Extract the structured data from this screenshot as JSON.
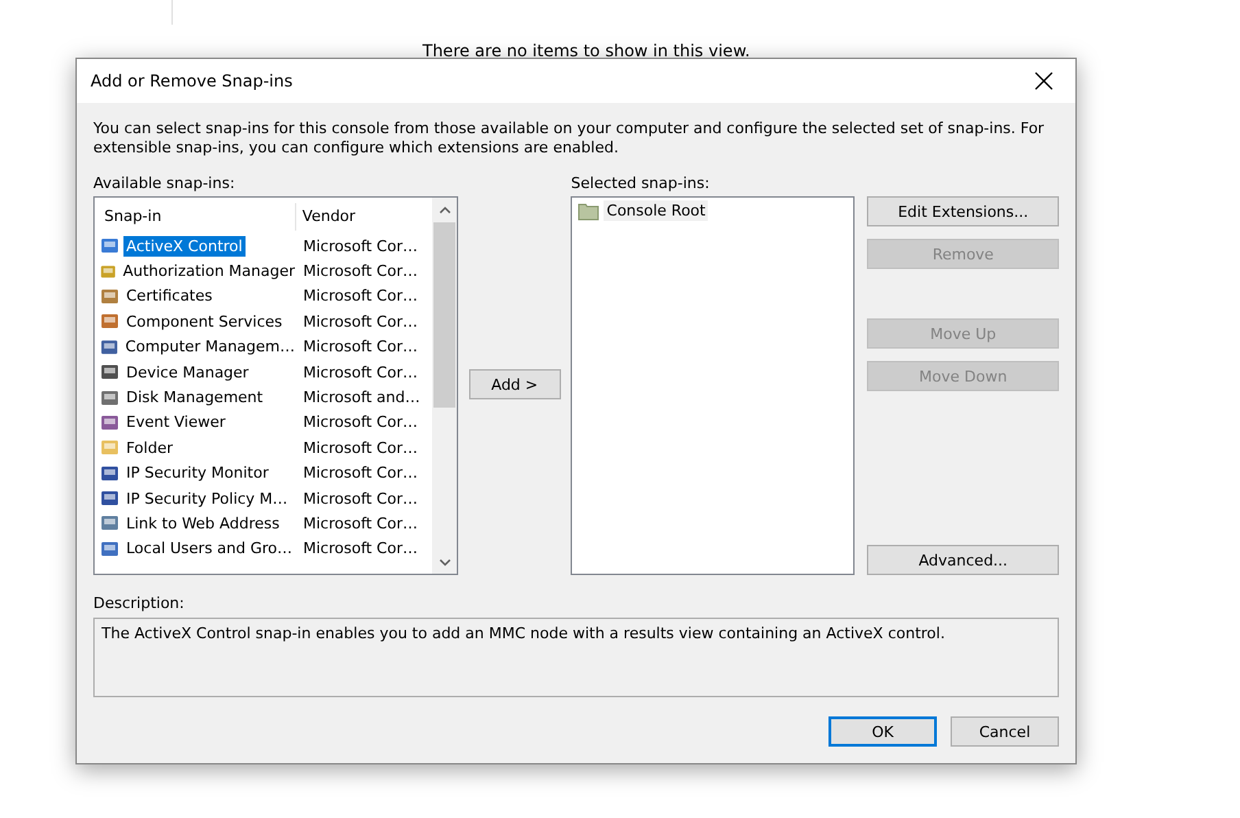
{
  "background": {
    "empty_message": "There are no items to show in this view."
  },
  "dialog": {
    "title": "Add or Remove Snap-ins",
    "intro": "You can select snap-ins for this console from those available on your computer and configure the selected set of snap-ins. For extensible snap-ins, you can configure which extensions are enabled.",
    "available": {
      "label": "Available snap-ins:",
      "columns": [
        "Snap-in",
        "Vendor"
      ],
      "rows": [
        {
          "name": "ActiveX Control",
          "vendor": "Microsoft Cor…",
          "selected": true
        },
        {
          "name": "Authorization Manager",
          "vendor": "Microsoft Cor…",
          "selected": false
        },
        {
          "name": "Certificates",
          "vendor": "Microsoft Cor…",
          "selected": false
        },
        {
          "name": "Component Services",
          "vendor": "Microsoft Cor…",
          "selected": false
        },
        {
          "name": "Computer Managem…",
          "vendor": "Microsoft Cor…",
          "selected": false
        },
        {
          "name": "Device Manager",
          "vendor": "Microsoft Cor…",
          "selected": false
        },
        {
          "name": "Disk Management",
          "vendor": "Microsoft and…",
          "selected": false
        },
        {
          "name": "Event Viewer",
          "vendor": "Microsoft Cor…",
          "selected": false
        },
        {
          "name": "Folder",
          "vendor": "Microsoft Cor…",
          "selected": false
        },
        {
          "name": "IP Security Monitor",
          "vendor": "Microsoft Cor…",
          "selected": false
        },
        {
          "name": "IP Security Policy M…",
          "vendor": "Microsoft Cor…",
          "selected": false
        },
        {
          "name": "Link to Web Address",
          "vendor": "Microsoft Cor…",
          "selected": false
        },
        {
          "name": "Local Users and Gro…",
          "vendor": "Microsoft Cor…",
          "selected": false
        }
      ]
    },
    "add_button": "Add >",
    "selected": {
      "label": "Selected snap-ins:",
      "items": [
        "Console Root"
      ]
    },
    "side_buttons": [
      {
        "label": "Edit Extensions...",
        "disabled": false
      },
      {
        "label": "Remove",
        "disabled": true
      },
      {
        "label": "Move Up",
        "disabled": true
      },
      {
        "label": "Move Down",
        "disabled": true
      },
      {
        "label": "Advanced...",
        "disabled": false
      }
    ],
    "description": {
      "label": "Description:",
      "text": "The ActiveX Control snap-in enables you to add an MMC node with a results view containing an ActiveX control."
    },
    "buttons": [
      {
        "label": "OK",
        "default": true
      },
      {
        "label": "Cancel",
        "default": false
      }
    ]
  }
}
